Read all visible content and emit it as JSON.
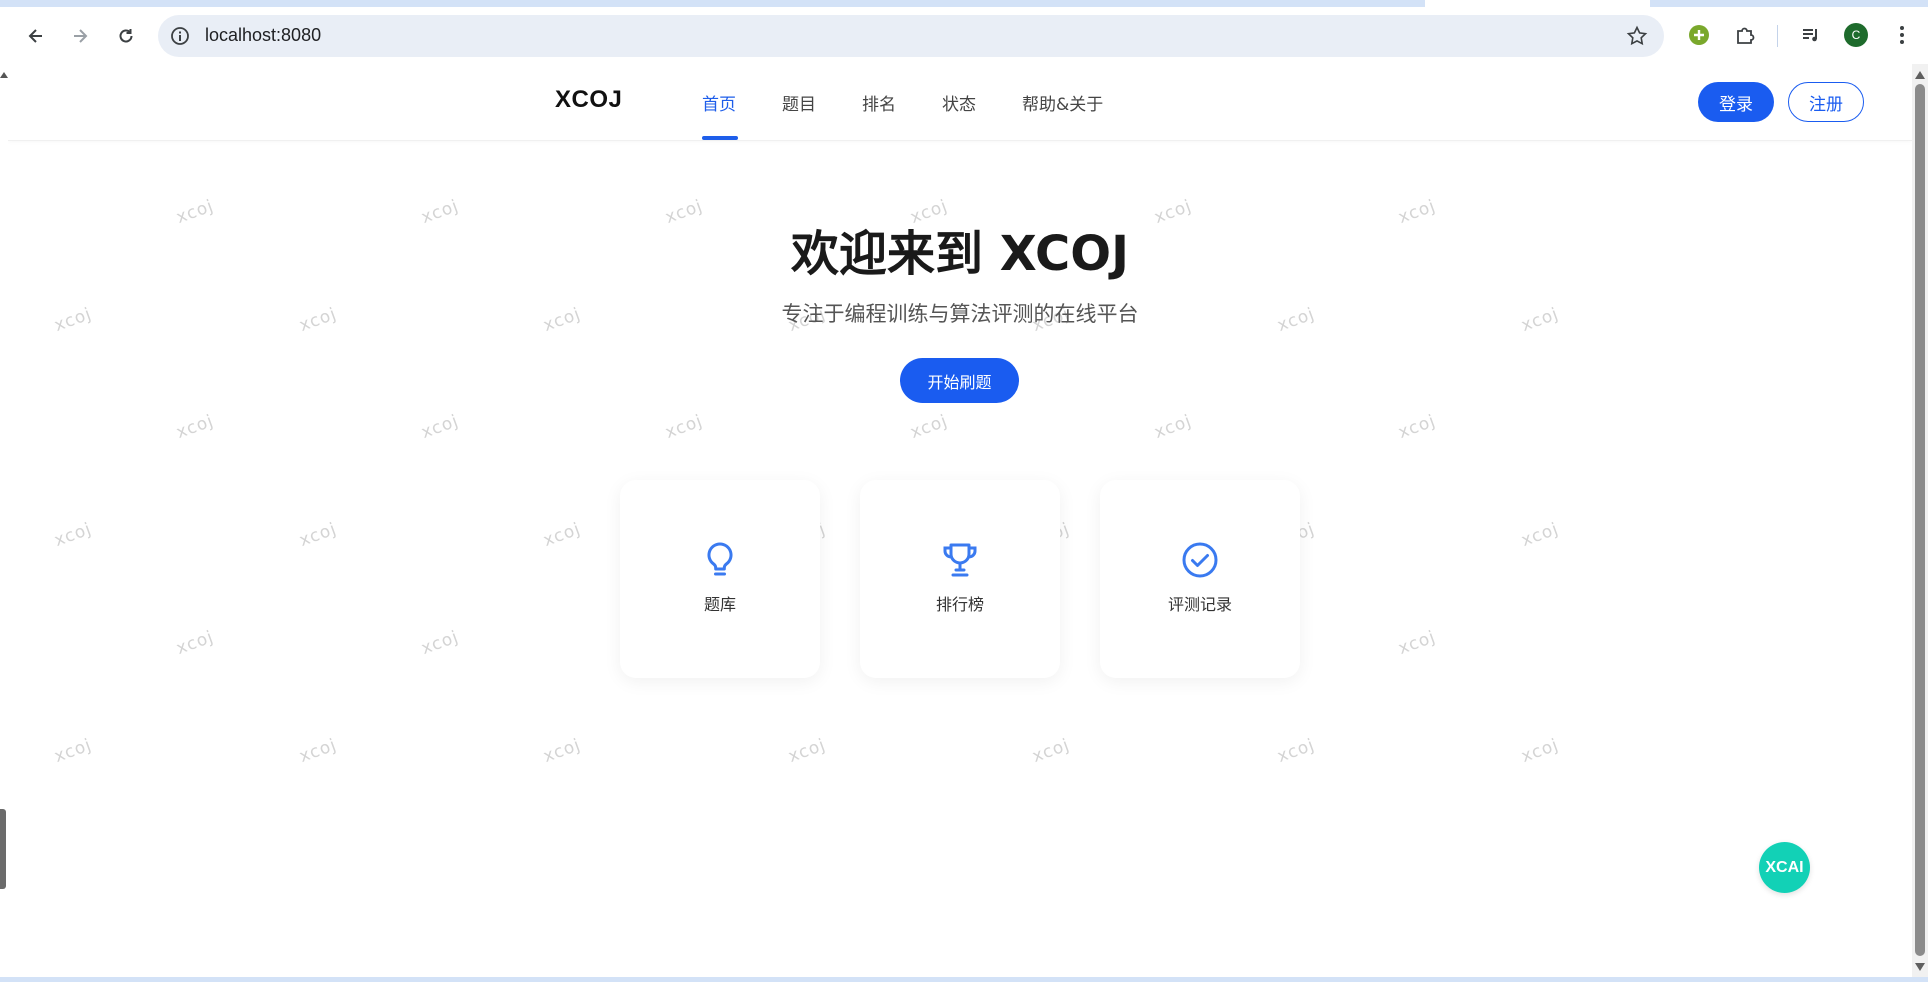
{
  "browser": {
    "url": "localhost:8080",
    "profile_initial": "C",
    "profile_color": "#1e6b2c",
    "extension_color": "#7aa82c"
  },
  "site": {
    "logo": "XCOJ",
    "nav": [
      "首页",
      "题目",
      "排名",
      "状态",
      "帮助&关于"
    ],
    "active_nav": "首页",
    "login_label": "登录",
    "register_label": "注册",
    "accent": "#1a5cf0"
  },
  "hero": {
    "title": "欢迎来到 XCOJ",
    "subtitle": "专注于编程训练与算法评测的在线平台",
    "cta_label": "开始刷题"
  },
  "features": [
    {
      "label": "题库",
      "icon": "lightbulb-icon"
    },
    {
      "label": "排行榜",
      "icon": "trophy-icon"
    },
    {
      "label": "评测记录",
      "icon": "check-circle-icon"
    }
  ],
  "watermark_text": "xcoj",
  "ai_button_label": "XCAI",
  "ai_button_color": "#12d1b6"
}
